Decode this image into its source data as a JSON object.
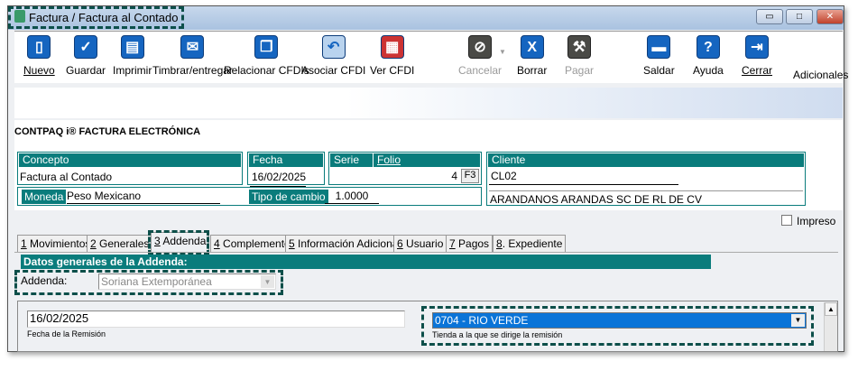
{
  "window": {
    "title": "Factura / Factura al Contado",
    "minimize": "▭",
    "restore": "□",
    "close": "✕"
  },
  "toolbar": {
    "items": [
      {
        "label": "Nuevo",
        "icon": "new-document-icon",
        "glyph": "▯"
      },
      {
        "label": "Guardar",
        "icon": "save-check-icon",
        "glyph": "✓"
      },
      {
        "label": "Imprimir",
        "icon": "print-icon",
        "glyph": "▤"
      },
      {
        "label": "Timbrar/entregar",
        "icon": "stamp-send-icon",
        "glyph": "✉"
      },
      {
        "label": "Relacionar CFDIs",
        "icon": "relate-cfdi-icon",
        "glyph": "❐"
      },
      {
        "label": "Asociar CFDI",
        "icon": "associate-cfdi-icon",
        "glyph": "↶"
      },
      {
        "label": "Ver CFDI",
        "icon": "view-cfdi-icon",
        "glyph": "▦"
      },
      {
        "label": "Cancelar",
        "icon": "cancel-icon",
        "glyph": "⊘"
      },
      {
        "label": "Borrar",
        "icon": "delete-icon",
        "glyph": "X"
      },
      {
        "label": "Pagar",
        "icon": "pay-icon",
        "glyph": "⚒"
      },
      {
        "label": "Saldar",
        "icon": "settle-icon",
        "glyph": "▬"
      },
      {
        "label": "Ayuda",
        "icon": "help-icon",
        "glyph": "?"
      },
      {
        "label": "Cerrar",
        "icon": "exit-door-icon",
        "glyph": "⇥"
      }
    ],
    "adicionales": "Adicionales"
  },
  "company": "CONTPAQ i® FACTURA ELECTRÓNICA",
  "header": {
    "concepto_label": "Concepto",
    "concepto": "Factura al Contado",
    "fecha_label": "Fecha",
    "fecha": "16/02/2025",
    "serie_label": "Serie",
    "folio_label": "Folio",
    "folio": "4",
    "f3": "F3",
    "moneda_label": "Moneda",
    "moneda": "Peso Mexicano",
    "tipo_cambio_label": "Tipo de cambio",
    "tipo_cambio": "1.0000",
    "cliente_label": "Cliente",
    "cliente_codigo": "CL02",
    "cliente_nombre": "ARANDANOS ARANDAS SC DE RL DE CV"
  },
  "impreso": "Impreso",
  "tabs": [
    {
      "n": "1",
      "label": " Movimientos"
    },
    {
      "n": "2",
      "label": " Generales"
    },
    {
      "n": "3",
      "label": " Addenda"
    },
    {
      "n": "4",
      "label": " Complemento"
    },
    {
      "n": "5",
      "label": " Información Adicional"
    },
    {
      "n": "6",
      "label": " Usuario"
    },
    {
      "n": "7",
      "label": " Pagos"
    },
    {
      "n": "8",
      "label": ". Expediente"
    }
  ],
  "addenda": {
    "section_title": "Datos generales de la Addenda:",
    "label": "Addenda:",
    "value": "Soriana Extemporánea",
    "fecha_remision": "16/02/2025",
    "fecha_remision_label": "Fecha de la Remisión",
    "tienda": "0704 - RIO VERDE",
    "tienda_label": "Tienda a la que se dirige la remisión"
  }
}
